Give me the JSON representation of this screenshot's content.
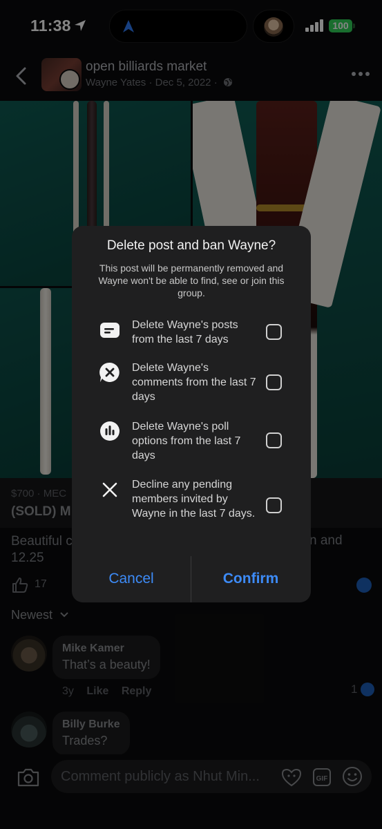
{
  "status_bar": {
    "time": "11:38",
    "battery": "100"
  },
  "header": {
    "group_name": "open billiards market",
    "author": "Wayne Yates",
    "date": "Dec 5, 2022",
    "separator": "·"
  },
  "listing": {
    "price": "$700 · MEC",
    "title": "(SOLD) M",
    "description_left": "Beautiful c",
    "description_right": "n and",
    "description_line2": "12.25",
    "like_count": "17"
  },
  "comments": {
    "sort_label": "Newest",
    "items": [
      {
        "name": "Mike Kamer",
        "text": "That’s a beauty!",
        "age": "3y",
        "like_label": "Like",
        "reply_label": "Reply",
        "likes": "1"
      },
      {
        "name": "Billy Burke",
        "text": "Trades?"
      }
    ]
  },
  "composer": {
    "placeholder": "Comment publicly as Nhut Min..."
  },
  "dialog": {
    "title": "Delete post and ban Wayne?",
    "message": "This post will be permanently removed and Wayne won't be able to find, see or join this group.",
    "options": [
      {
        "label": "Delete Wayne's posts from the last 7 days",
        "icon": "post-icon",
        "checked": false
      },
      {
        "label": "Delete Wayne's comments from the last 7 days",
        "icon": "comment-x-icon",
        "checked": false
      },
      {
        "label": "Delete Wayne's poll options from the last 7 days",
        "icon": "poll-icon",
        "checked": false
      },
      {
        "label": "Decline any pending members invited by Wayne in the last 7 days.",
        "icon": "close-icon",
        "checked": false
      }
    ],
    "cancel_label": "Cancel",
    "confirm_label": "Confirm"
  },
  "colors": {
    "accent": "#3d8bf7",
    "battery": "#30d158",
    "dialog_bg": "#1f1f20"
  }
}
